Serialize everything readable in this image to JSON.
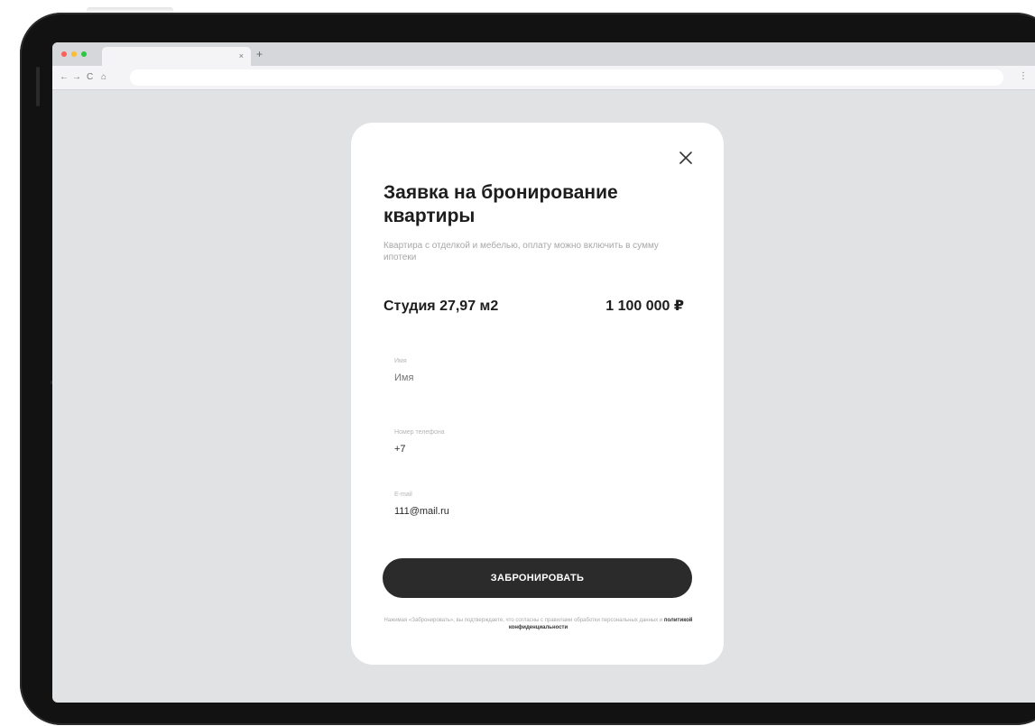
{
  "browser": {
    "traffic_lights": [
      "#ff5f57",
      "#febc2e",
      "#28c840"
    ],
    "tab": {
      "title": "",
      "close_label": "×"
    },
    "new_tab_label": "+",
    "nav": {
      "back": "←",
      "forward": "→",
      "reload": "C",
      "home": "⌂"
    },
    "url": "",
    "menu": "⋮"
  },
  "modal": {
    "close_label": "✕",
    "title": "Заявка на бронирование квартиры",
    "subtitle": "Квартира с отделкой и мебелью, оплату можно включить в сумму ипотеки",
    "apartment": {
      "name": "Студия 27,97 м2",
      "price": "1 100 000 ₽"
    },
    "form": {
      "name": {
        "label": "Имя",
        "value": "",
        "placeholder": "Имя"
      },
      "phone": {
        "label": "Номер телефона",
        "value": "+7",
        "placeholder": ""
      },
      "email": {
        "label": "E-mail",
        "value": "111@mail.ru",
        "placeholder": ""
      }
    },
    "submit_label": "ЗАБРОНИРОВАТЬ",
    "consent": {
      "text": "Нажимая «Забронировать», вы подтверждаете, что согласны с правилами обработки персональных данных и",
      "link": "политикой конфиденциальности"
    }
  },
  "colors": {
    "screen_bg": "#e1e2e4",
    "modal_bg": "#ffffff",
    "button_bg": "#2b2b2b",
    "text_primary": "#1d1d1d",
    "text_muted": "#a7a7a7",
    "device_frame": "#121212"
  }
}
